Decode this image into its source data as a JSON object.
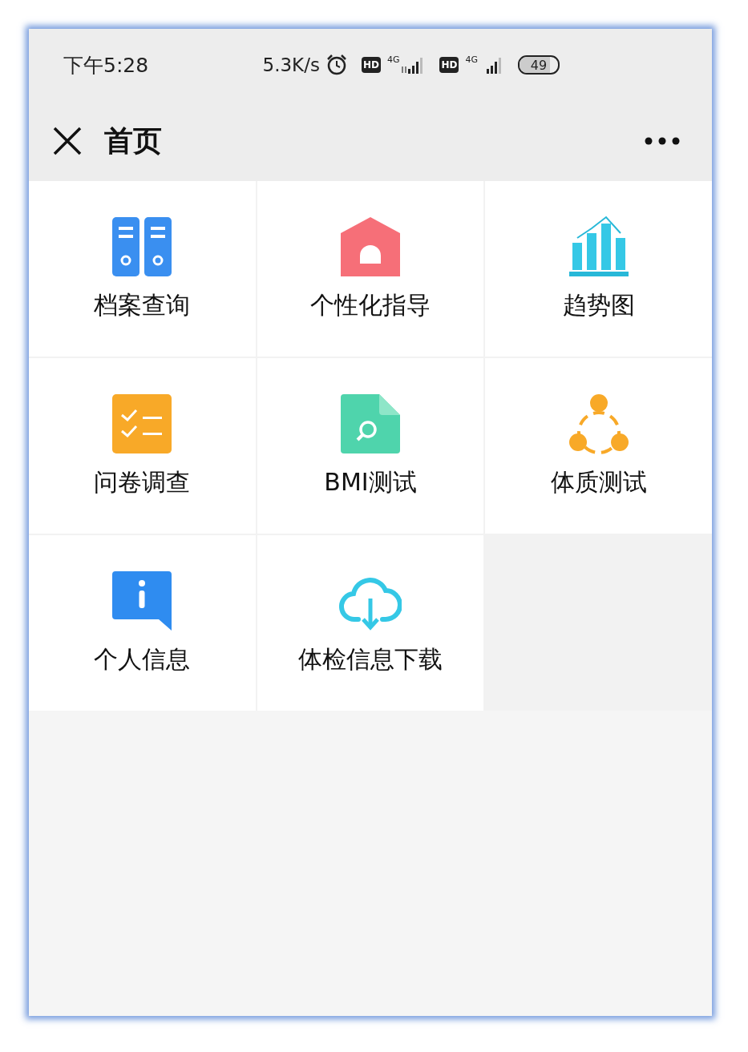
{
  "status_bar": {
    "time": "下午5:28",
    "speed": "5.3K/s",
    "sims": [
      {
        "hd": "HD",
        "network": "4G",
        "arrows": true
      },
      {
        "hd": "HD",
        "network": "4G",
        "arrows": false
      }
    ],
    "battery": "49"
  },
  "nav_bar": {
    "title": "首页"
  },
  "grid": [
    {
      "label": "档案查询",
      "kind": "folders"
    },
    {
      "label": "个性化指导",
      "kind": "house"
    },
    {
      "label": "趋势图",
      "kind": "chart"
    },
    {
      "label": "问卷调查",
      "kind": "checklist"
    },
    {
      "label": "BMI测试",
      "kind": "doc-search"
    },
    {
      "label": "体质测试",
      "kind": "network"
    },
    {
      "label": "个人信息",
      "kind": "info"
    },
    {
      "label": "体检信息下载",
      "kind": "cloud-download"
    }
  ]
}
